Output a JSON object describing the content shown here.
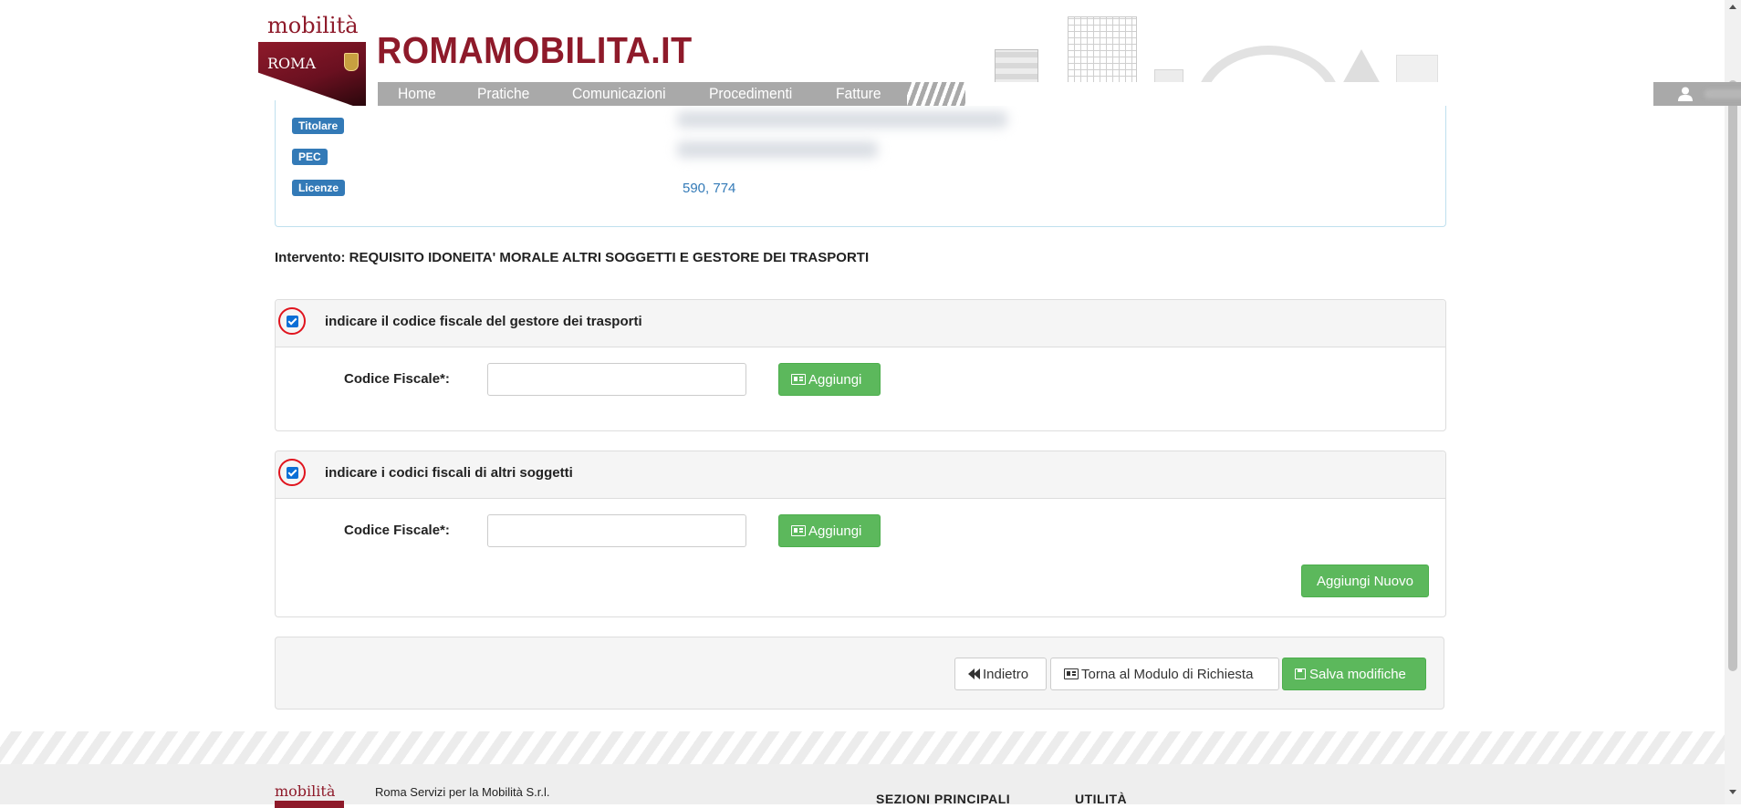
{
  "header": {
    "logo_top": "mobilità",
    "logo_city": "ROMA",
    "brand": "ROMAMOBILITA.IT",
    "nav": [
      {
        "label": "Home"
      },
      {
        "label": "Pratiche"
      },
      {
        "label": "Comunicazioni"
      },
      {
        "label": "Procedimenti"
      },
      {
        "label": "Fatture"
      }
    ]
  },
  "info": {
    "titolare_label": "Titolare",
    "pec_label": "PEC",
    "licenze_label": "Licenze",
    "licenze_value": "590, 774"
  },
  "intervento": "Intervento: REQUISITO IDONEITA' MORALE ALTRI SOGGETTI E GESTORE DEI TRASPORTI",
  "panel_gestore": {
    "checked": true,
    "title": "indicare il codice fiscale del gestore dei trasporti",
    "field_label": "Codice Fiscale*:",
    "input_value": "",
    "add_label": "Aggiungi"
  },
  "panel_altri": {
    "checked": true,
    "title": "indicare i codici fiscali di altri soggetti",
    "field_label": "Codice Fiscale*:",
    "input_value": "",
    "add_label": "Aggiungi",
    "add_new_label": "Aggiungi Nuovo"
  },
  "actions": {
    "back_label": "Indietro",
    "return_label": "Torna al Modulo di Richiesta",
    "save_label": "Salva modifiche"
  },
  "footer": {
    "logo": "mobilità",
    "company": "Roma Servizi per la Mobilità S.r.l.",
    "sections_heading": "SEZIONI PRINCIPALI",
    "utility_heading": "UTILITÀ"
  },
  "colors": {
    "brand": "#8e1a2a",
    "label_blue": "#337ab7",
    "success_green": "#5cb85c",
    "highlight_red": "#e0141e",
    "checkbox_blue": "#0b6fd6"
  },
  "icons": {
    "user": "user-icon",
    "add_button": "id-card-icon",
    "back_button": "backward-icon",
    "save_button": "floppy-disk-icon",
    "dropdown": "caret-down-icon"
  }
}
